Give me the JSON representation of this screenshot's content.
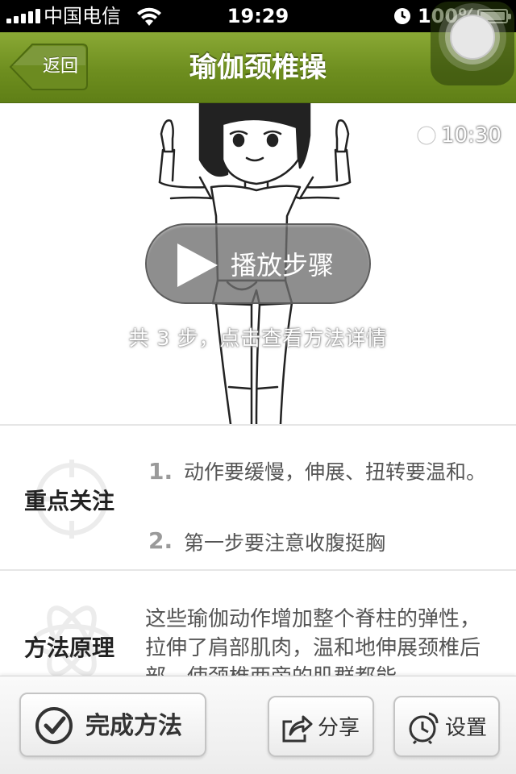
{
  "status_bar": {
    "carrier": "中国电信",
    "time": "19:29",
    "battery": "100%"
  },
  "nav": {
    "back_label": "返回",
    "title": "瑜伽颈椎操"
  },
  "video": {
    "duration": "10:30",
    "play_label": "播放步骤",
    "steps_hint": "共 3 步，点击查看方法详情"
  },
  "key_points": {
    "label": "重点关注",
    "items": [
      {
        "num": "1.",
        "text": "动作要缓慢，伸展、扭转要温和。"
      },
      {
        "num": "2.",
        "text": "第一步要注意收腹挺胸"
      }
    ]
  },
  "principle": {
    "label": "方法原理",
    "text": "这些瑜伽动作增加整个脊柱的弹性，拉伸了肩部肌肉，温和地伸展颈椎后部，使颈椎两旁的肌群都能"
  },
  "toolbar": {
    "complete_label": "完成方法",
    "share_label": "分享",
    "settings_label": "设置"
  },
  "icons": {
    "back": "back-arrow-icon",
    "clock": "clock-icon",
    "play": "play-icon",
    "target": "target-icon",
    "atom": "atom-icon",
    "check": "check-circle-icon",
    "share": "share-icon",
    "alarm": "alarm-clock-icon"
  },
  "colors": {
    "nav_green": "#7a9a28",
    "accent_text": "#333333"
  }
}
